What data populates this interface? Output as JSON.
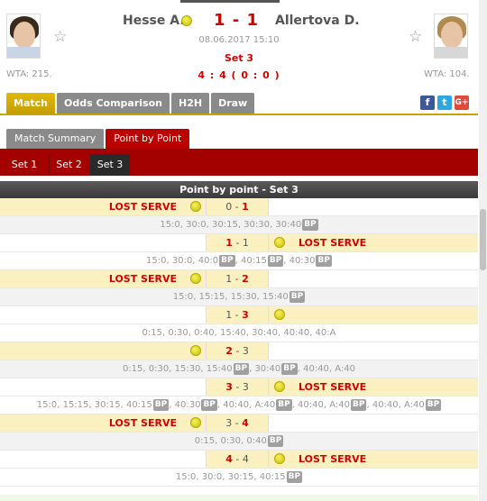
{
  "match": {
    "home_name": "Hesse A.",
    "away_name": "Allertova D.",
    "score": "1 - 1",
    "datetime": "08.06.2017 15:10",
    "set_label": "Set 3",
    "game_score": "4 : 4 ( 0 : 0 )",
    "home_rank": "WTA: 215.",
    "away_rank": "WTA: 104.",
    "serving": "home"
  },
  "icons": {
    "star": "star-icon",
    "ball": "tennis-ball-icon",
    "facebook": "f",
    "twitter": "t",
    "googleplus": "G+"
  },
  "tabs": [
    "Match",
    "Odds Comparison",
    "H2H",
    "Draw"
  ],
  "subtabs": [
    "Match Summary",
    "Point by Point"
  ],
  "sets": [
    "Set 1",
    "Set 2",
    "Set 3"
  ],
  "table_title": "Point by point - Set 3",
  "lost_serve_label": "LOST SERVE",
  "bp_label": "BP",
  "games": [
    {
      "server": "home",
      "lost": "home",
      "score_home": "0",
      "score_away": "1",
      "winner": "away",
      "points": [
        [
          "15:0",
          false
        ],
        [
          "30:0",
          false
        ],
        [
          "30:15",
          false
        ],
        [
          "30:30",
          false
        ],
        [
          "30:40",
          true
        ]
      ]
    },
    {
      "server": "away",
      "lost": "away",
      "score_home": "1",
      "score_away": "1",
      "winner": "home",
      "points": [
        [
          "15:0",
          false
        ],
        [
          "30:0",
          false
        ],
        [
          "40:0",
          true
        ],
        [
          "40:15",
          true
        ],
        [
          "40:30",
          true
        ]
      ]
    },
    {
      "server": "home",
      "lost": "home",
      "score_home": "1",
      "score_away": "2",
      "winner": "away",
      "points": [
        [
          "15:0",
          false
        ],
        [
          "15:15",
          false
        ],
        [
          "15:30",
          false
        ],
        [
          "15:40",
          true
        ]
      ]
    },
    {
      "server": "away",
      "lost": "",
      "score_home": "1",
      "score_away": "3",
      "winner": "away",
      "points": [
        [
          "0:15",
          false
        ],
        [
          "0:30",
          false
        ],
        [
          "0:40",
          false
        ],
        [
          "15:40",
          false
        ],
        [
          "30:40",
          false
        ],
        [
          "40:40",
          false
        ],
        [
          "40:A",
          false
        ]
      ]
    },
    {
      "server": "home",
      "lost": "",
      "score_home": "2",
      "score_away": "3",
      "winner": "home",
      "points": [
        [
          "0:15",
          false
        ],
        [
          "0:30",
          false
        ],
        [
          "15:30",
          false
        ],
        [
          "15:40",
          true
        ],
        [
          "30:40",
          true
        ],
        [
          "40:40",
          false
        ],
        [
          "A:40",
          false
        ]
      ]
    },
    {
      "server": "away",
      "lost": "away",
      "score_home": "3",
      "score_away": "3",
      "winner": "home",
      "points": [
        [
          "15:0",
          false
        ],
        [
          "15:15",
          false
        ],
        [
          "30:15",
          false
        ],
        [
          "40:15",
          true
        ],
        [
          "40:30",
          true
        ],
        [
          "40:40",
          false
        ],
        [
          "A:40",
          true
        ],
        [
          "40:40",
          false
        ],
        [
          "A:40",
          true
        ],
        [
          "40:40",
          false
        ],
        [
          "A:40",
          true
        ]
      ]
    },
    {
      "server": "home",
      "lost": "home",
      "score_home": "3",
      "score_away": "4",
      "winner": "away",
      "points": [
        [
          "0:15",
          false
        ],
        [
          "0:30",
          false
        ],
        [
          "0:40",
          true
        ]
      ]
    },
    {
      "server": "away",
      "lost": "away",
      "score_home": "4",
      "score_away": "4",
      "winner": "home",
      "points": [
        [
          "15:0",
          false
        ],
        [
          "30:0",
          false
        ],
        [
          "30:15",
          false
        ],
        [
          "40:15",
          true
        ]
      ]
    }
  ]
}
